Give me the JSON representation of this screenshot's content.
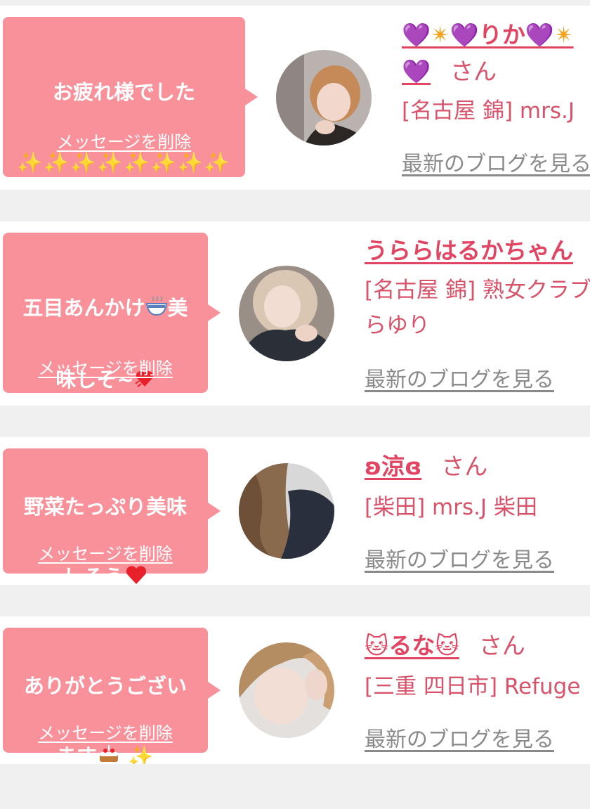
{
  "messages": [
    {
      "bubble_text": "お疲れ様でした",
      "bubble_sparkles": "✨✨✨✨✨✨✨✨",
      "delete_label": "メッセージを削除",
      "name": "💜✴️💜りか💜✴️",
      "name_line2": "💜",
      "san": "さん",
      "shop": "[名古屋 錦] mrs.J",
      "blog_label": "最新のブログを見る"
    },
    {
      "bubble_text": "五目あんかけ",
      "bubble_text_2": "美",
      "bubble_text_3": "味しそ~",
      "delete_label": "メッセージを削除",
      "name": "うららはるかちゃん",
      "shop": "[名古屋 錦] 熟女クラブ\nらゆり",
      "blog_label": "最新のブログを見る"
    },
    {
      "bubble_text": "野菜たっぷり美味",
      "bubble_text_2": "しそう",
      "delete_label": "メッセージを削除",
      "name": "ʚ涼ɞ",
      "san": "さん",
      "shop": "[柴田] mrs.J 柴田",
      "blog_label": "最新のブログを見る"
    },
    {
      "bubble_text": "ありがとうござい",
      "bubble_text_2": "ます",
      "bubble_sparkle": "✨",
      "delete_label": "メッセージを削除",
      "name": "🐱るな🐱",
      "san": "さん",
      "shop": "[三重 四日市] Refuge",
      "blog_label": "最新のブログを見る"
    }
  ],
  "colors": {
    "bubble": "#f9919b",
    "name": "#e14562",
    "shop": "#d8526a",
    "blog_link": "#8a8a8a",
    "background": "#f0f0f0"
  }
}
